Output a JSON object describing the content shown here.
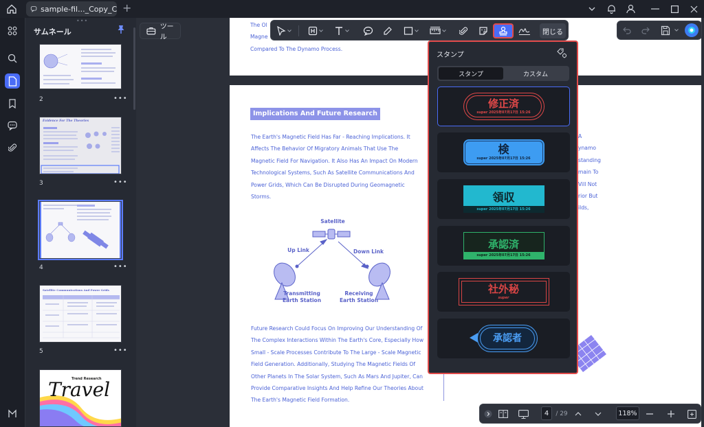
{
  "tab": {
    "title": "sample-fil..._Copy_Copy"
  },
  "sidebar": {
    "title": "サムネール"
  },
  "thumbnails": [
    {
      "page": "2",
      "more": "•••"
    },
    {
      "page": "3",
      "more": "•••",
      "heading": "Evidence For The Theories"
    },
    {
      "page": "4",
      "more": "•••"
    },
    {
      "page": "5",
      "more": "•••",
      "heading": "Satellite Communications And Power Grids"
    },
    {
      "page": "",
      "heading1": "Trend Research",
      "script": "Travel"
    }
  ],
  "tools_button": "ツール",
  "toolbar": {
    "close_label": "閉じる"
  },
  "page_top": {
    "lines": [
      "The Ol",
      "Magne",
      "Compared To The Dynamo Process."
    ]
  },
  "page_main": {
    "heading": "Implications And Future Research",
    "para1": [
      "The Earth's Magnetic Field Has Far - Reaching Implications. It",
      "Affects The Behavior Of Migratory Animals That Use The",
      "Magnetic Field For Navigation. It Also Has An Impact On Modern",
      "Technological Systems, Such As Satellite Communications And",
      "Power Grids, Which Can Be Disrupted During Geomagnetic",
      "Storms."
    ],
    "para2": [
      "Future Research Could Focus On Improving Our Understanding Of",
      "The Complex Interactions Within The Earth's Core, Especially How",
      "Small - Scale Processes Contribute To The Large - Scale Magnetic",
      "Field Generation. Additionally, Studying The Magnetic Fields Of",
      "Other Planets In The Solar System, Such As Mars And Jupiter, Can",
      "Provide Comparative Insights And Help Refine Our Theories About",
      "The Earth's Magnetic Field Formation."
    ],
    "right_col": [
      "A",
      "ynamo",
      "standing",
      "main To",
      "Vill Not",
      "rior But",
      "ilds,"
    ],
    "diagram": {
      "satellite": "Satellite",
      "uplink": "Up Link",
      "downlink": "Down Link",
      "tx1": "Transmitting",
      "tx2": "Earth Station",
      "rx1": "Receiving",
      "rx2": "Earth Station"
    }
  },
  "stamp_panel": {
    "title": "スタンプ",
    "tab_stamp": "スタンプ",
    "tab_custom": "カスタム",
    "stamps": [
      {
        "text": "修正済",
        "sub": "super 2025年07月17日 15:26",
        "color": "#e04848"
      },
      {
        "text": "検",
        "sub": "super 2025年07月17日 15:26",
        "color": "#3d9cf2"
      },
      {
        "text": "領収",
        "sub": "super 2025年07月17日 15:26",
        "color": "#22b8cf"
      },
      {
        "text": "承認済",
        "sub": "super 2025年07月17日 15:26",
        "color": "#2fb36b"
      },
      {
        "text": "社外秘",
        "sub": "super",
        "color": "#d94545"
      },
      {
        "text": "承認者",
        "sub": "",
        "color": "#4a9cf2"
      }
    ]
  },
  "bottom_bar": {
    "current_page": "4",
    "total_pages": "/ 29",
    "zoom": "118%"
  },
  "colors": {
    "accent": "#4a6cf7",
    "highlight_border": "#e14b4b",
    "doc_text": "#4b62d6"
  }
}
